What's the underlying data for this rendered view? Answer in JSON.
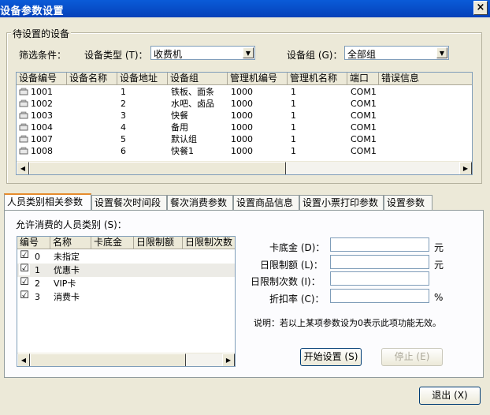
{
  "window": {
    "title": "设备参数设置",
    "close_glyph": "×"
  },
  "device_group": {
    "label": "待设置的设备",
    "filter_label": "筛选条件：",
    "type_label": "设备类型 (T)：",
    "type_value": "收费机",
    "group_label": "设备组 (G)：",
    "group_value": "全部组",
    "columns": [
      "设备编号",
      "设备名称",
      "设备地址",
      "设备组",
      "管理机编号",
      "管理机名称",
      "端口",
      "错误信息"
    ],
    "rows": [
      {
        "id": "1001",
        "name": "",
        "addr": "1",
        "group": "铁板、面条",
        "mgr_id": "1000",
        "mgr_name": "1",
        "port": "COM1",
        "error": ""
      },
      {
        "id": "1002",
        "name": "",
        "addr": "2",
        "group": "水吧、卤品",
        "mgr_id": "1000",
        "mgr_name": "1",
        "port": "COM1",
        "error": ""
      },
      {
        "id": "1003",
        "name": "",
        "addr": "3",
        "group": "快餐",
        "mgr_id": "1000",
        "mgr_name": "1",
        "port": "COM1",
        "error": ""
      },
      {
        "id": "1004",
        "name": "",
        "addr": "4",
        "group": "备用",
        "mgr_id": "1000",
        "mgr_name": "1",
        "port": "COM1",
        "error": ""
      },
      {
        "id": "1007",
        "name": "",
        "addr": "5",
        "group": "默认组",
        "mgr_id": "1000",
        "mgr_name": "1",
        "port": "COM1",
        "error": ""
      },
      {
        "id": "1008",
        "name": "",
        "addr": "6",
        "group": "快餐1",
        "mgr_id": "1000",
        "mgr_name": "1",
        "port": "COM1",
        "error": ""
      }
    ]
  },
  "tabs": [
    "人员类别相关参数",
    "设置餐次时间段",
    "餐次消费参数",
    "设置商品信息",
    "设置小票打印参数",
    "设置参数"
  ],
  "staff_panel": {
    "allowed_label": "允许消费的人员类别 (S)：",
    "columns": [
      "编号",
      "名称",
      "卡底金",
      "日限制额",
      "日限制次数"
    ],
    "rows": [
      {
        "num": "0",
        "name": "未指定",
        "checked": "☑"
      },
      {
        "num": "1",
        "name": "优惠卡",
        "checked": "☑"
      },
      {
        "num": "2",
        "name": "VIP卡",
        "checked": "☑"
      },
      {
        "num": "3",
        "name": "消费卡",
        "checked": "☑"
      }
    ],
    "card_base_label": "卡底金 (D)：",
    "daily_limit_label": "日限制额 (L)：",
    "daily_count_label": "日限制次数 (I)：",
    "discount_label": "折扣率 (C)：",
    "unit_yuan": "元",
    "unit_percent": "%",
    "note": "说明：若以上某项参数设为0表示此项功能无效。",
    "start_button": "开始设置 (S)",
    "stop_button": "停止 (E)"
  },
  "exit_button": "退出 (X)"
}
